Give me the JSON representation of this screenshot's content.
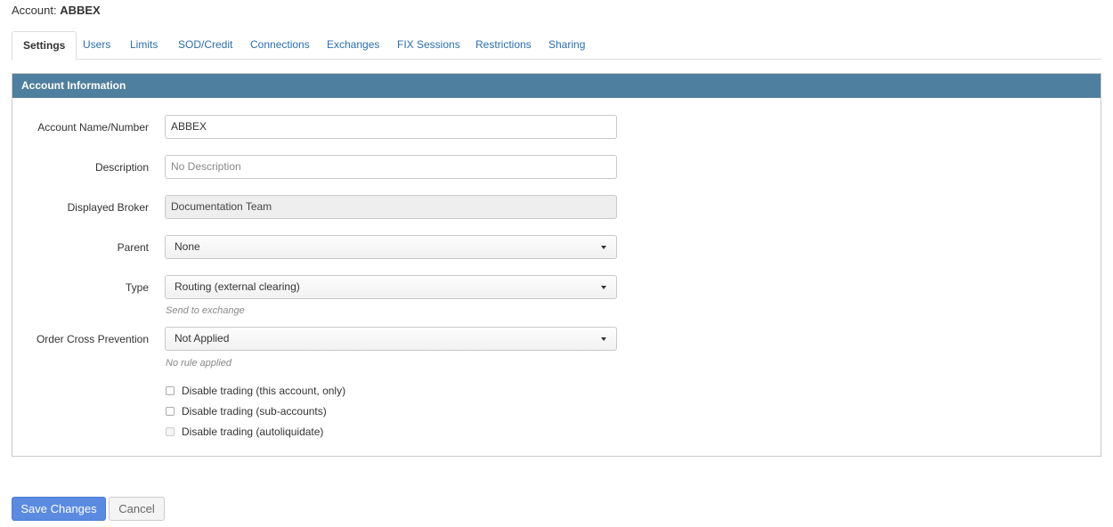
{
  "header": {
    "prefix": "Account:",
    "account": "ABBEX"
  },
  "tabs": [
    {
      "label": "Settings",
      "active": true
    },
    {
      "label": "Users"
    },
    {
      "label": "Limits"
    },
    {
      "label": "SOD/Credit"
    },
    {
      "label": "Connections"
    },
    {
      "label": "Exchanges"
    },
    {
      "label": "FIX Sessions"
    },
    {
      "label": "Restrictions"
    },
    {
      "label": "Sharing"
    }
  ],
  "panel": {
    "title": "Account Information"
  },
  "form": {
    "account_name": {
      "label": "Account Name/Number",
      "value": "ABBEX"
    },
    "description": {
      "label": "Description",
      "placeholder": "No Description"
    },
    "displayed_broker": {
      "label": "Displayed Broker",
      "value": "Documentation Team"
    },
    "parent": {
      "label": "Parent",
      "value": "None"
    },
    "type": {
      "label": "Type",
      "value": "Routing (external clearing)",
      "help": "Send to exchange"
    },
    "order_cross_prevention": {
      "label": "Order Cross Prevention",
      "value": "Not Applied",
      "help": "No rule applied"
    },
    "checkboxes": [
      {
        "label": "Disable trading (this account, only)",
        "checked": false,
        "disabled": false
      },
      {
        "label": "Disable trading (sub-accounts)",
        "checked": false,
        "disabled": false
      },
      {
        "label": "Disable trading (autoliquidate)",
        "checked": false,
        "disabled": true
      }
    ]
  },
  "actions": {
    "save_label": "Save Changes",
    "cancel_label": "Cancel"
  }
}
